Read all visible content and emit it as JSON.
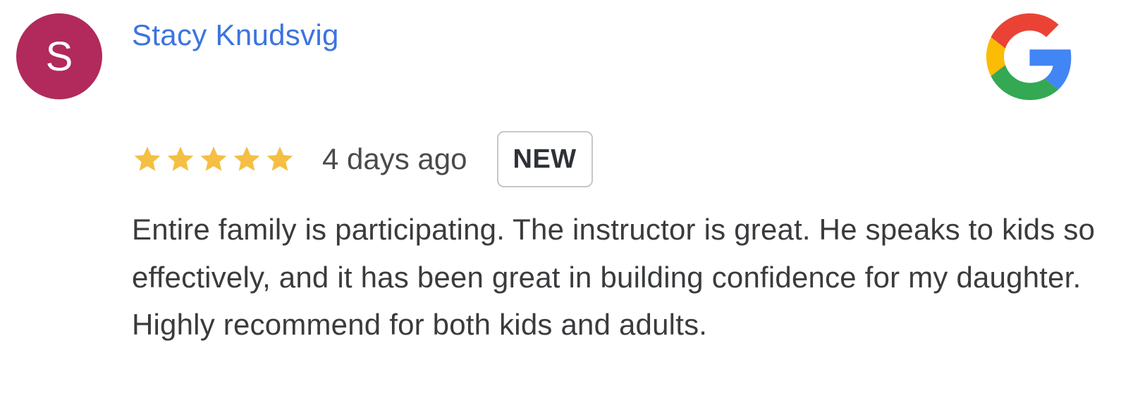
{
  "review": {
    "author": {
      "initial": "S",
      "name": "Stacy Knudsvig",
      "avatar_color": "#b12a5b",
      "name_color": "#3b74e0"
    },
    "source_icon": "google-g-icon",
    "rating": 5,
    "rating_max": 5,
    "star_color": "#f4bf42",
    "date": "4 days ago",
    "badge": "NEW",
    "text": "Entire family is participating. The instructor is great. He speaks to kids so effectively, and it has been great in building confidence for my daughter. Highly recommend for both kids and adults."
  }
}
